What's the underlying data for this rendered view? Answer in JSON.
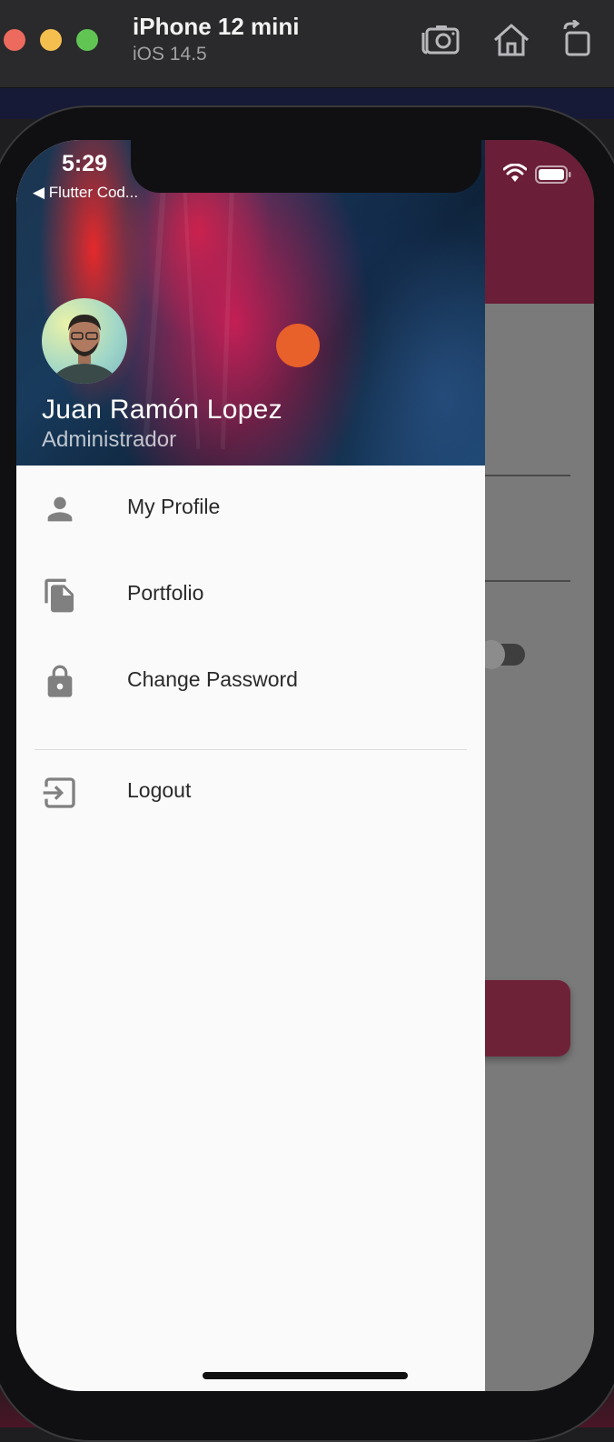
{
  "simulator": {
    "device_name": "iPhone 12 mini",
    "os_version": "iOS 14.5",
    "buttons": [
      "screenshot-icon",
      "home-icon",
      "rotate-icon"
    ]
  },
  "status_bar": {
    "time": "5:29",
    "back_app": "◀ Flutter Cod..."
  },
  "drawer": {
    "header": {
      "user_name": "Juan Ramón Lopez",
      "user_role": "Administrador"
    },
    "items": [
      {
        "label": "My Profile",
        "icon": "person-icon"
      },
      {
        "label": "Portfolio",
        "icon": "file-copy-icon"
      },
      {
        "label": "Change Password",
        "icon": "lock-icon"
      },
      {
        "label": "Logout",
        "icon": "exit-icon"
      }
    ]
  },
  "colors": {
    "app_bar": "#6a1e38",
    "accent_dot": "#e8602a",
    "drawer_bg": "#fafafa",
    "icon": "#808080"
  }
}
